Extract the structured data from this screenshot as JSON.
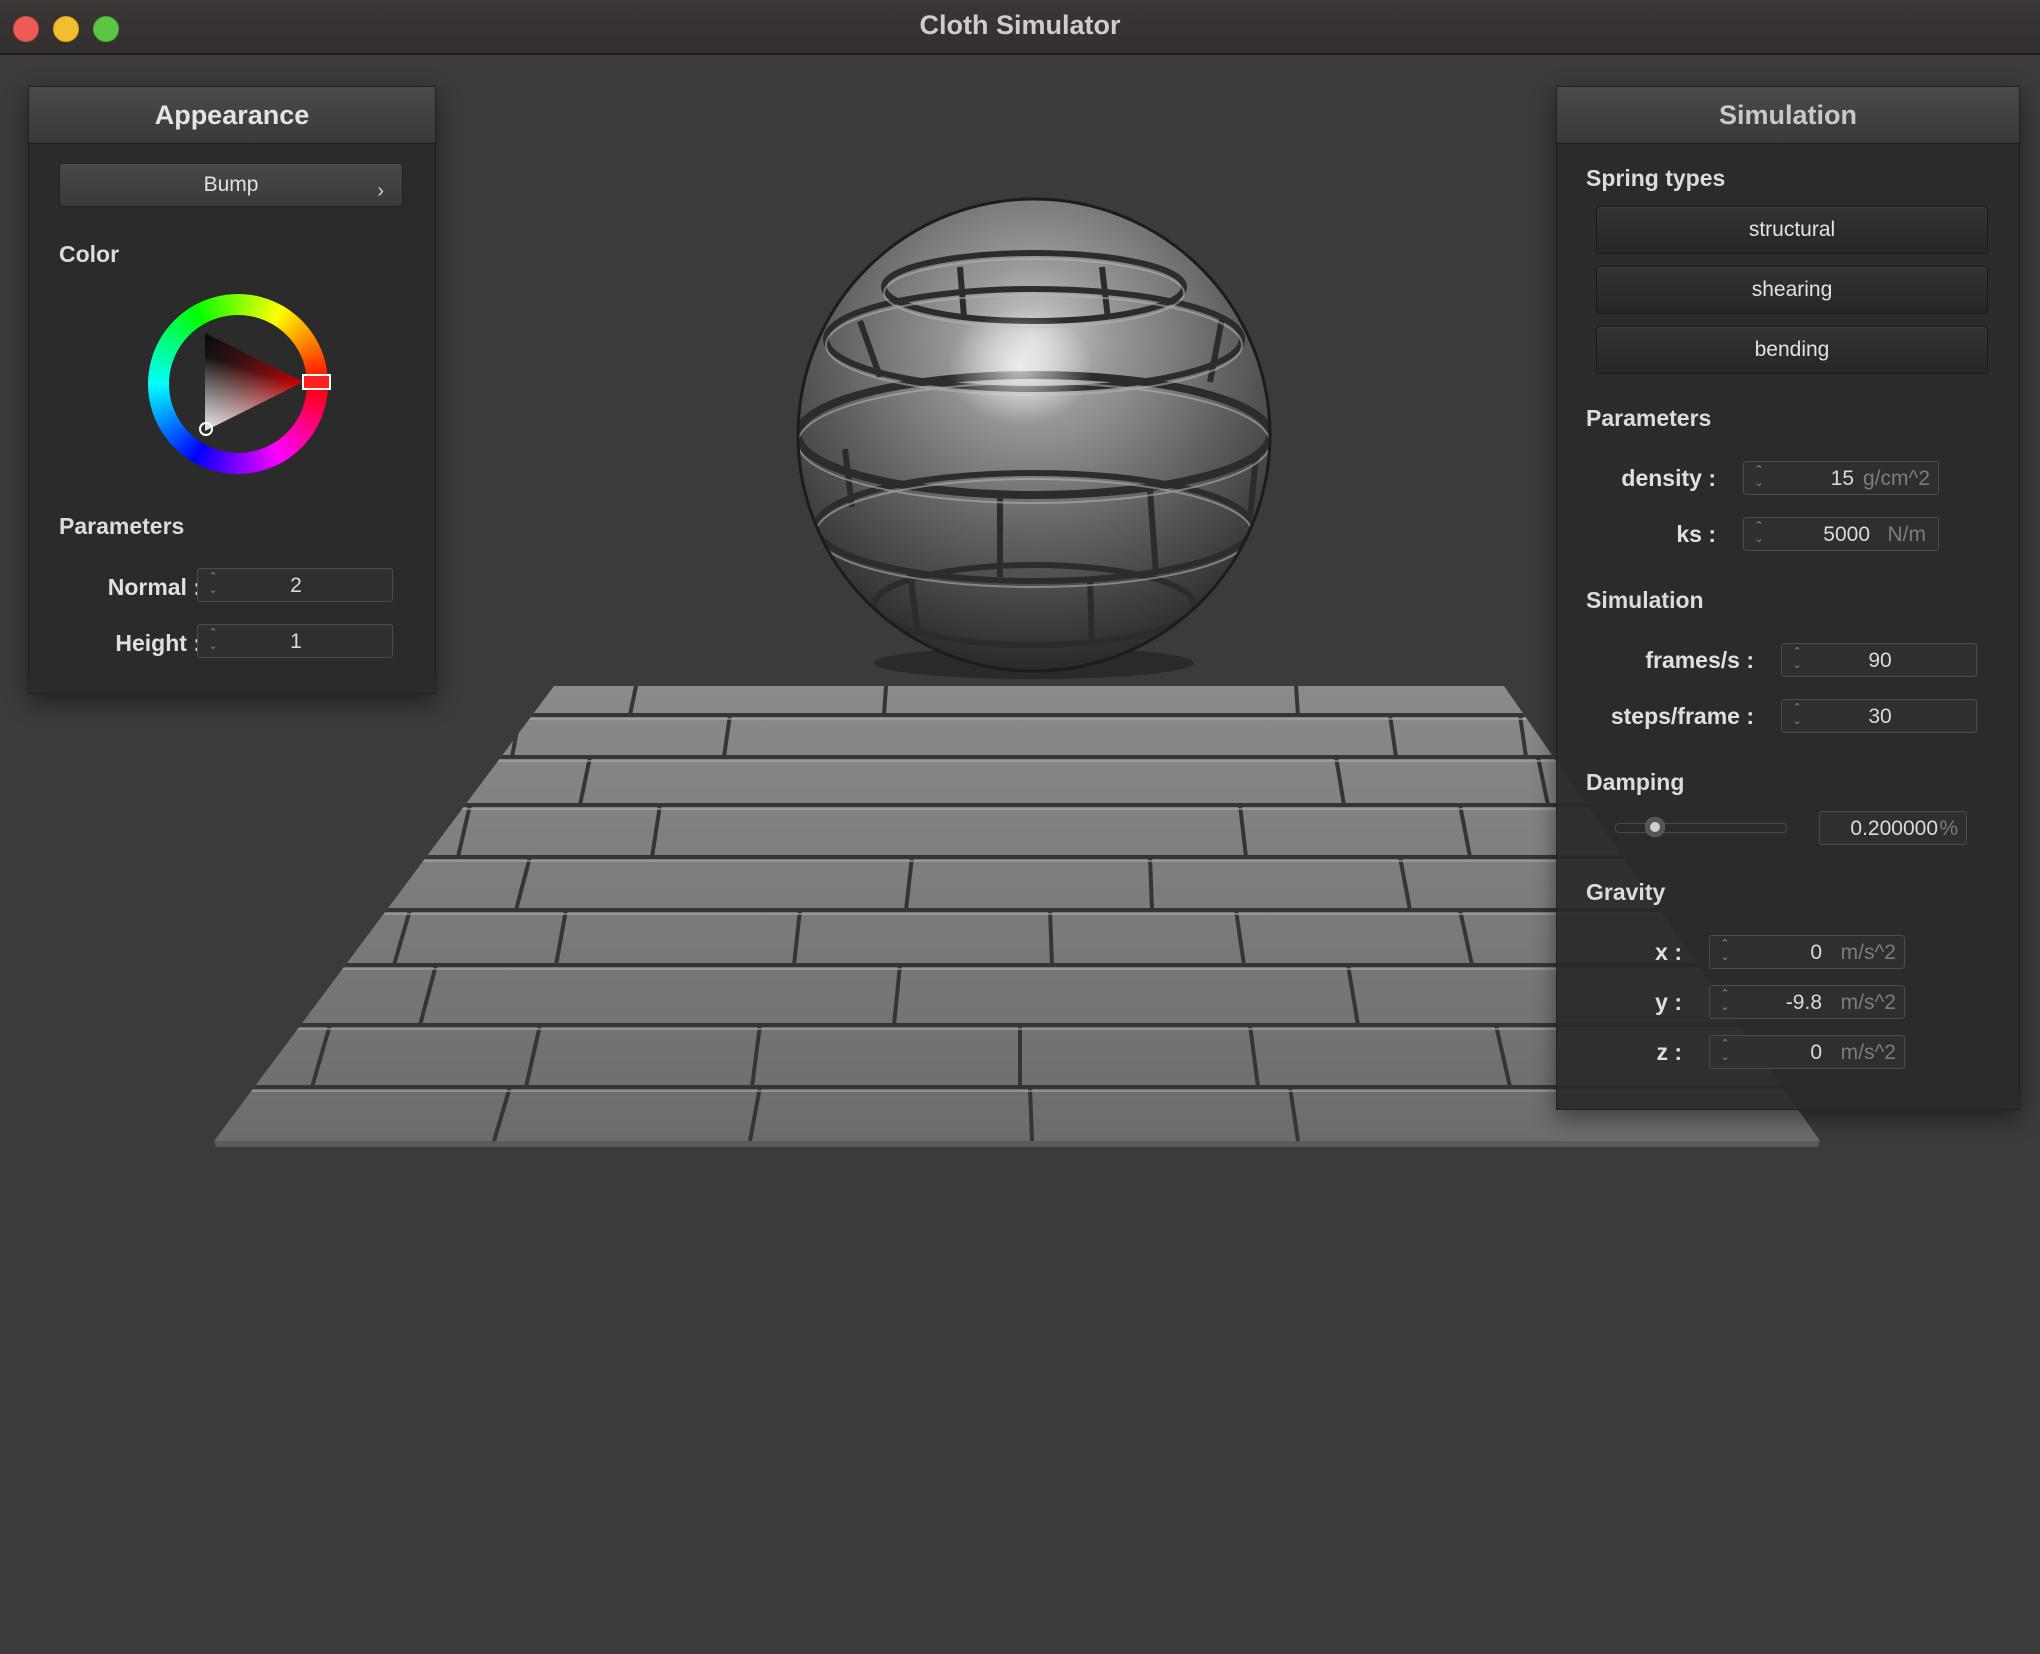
{
  "window": {
    "title": "Cloth Simulator"
  },
  "appearance": {
    "header": "Appearance",
    "shader_selected": "Bump",
    "color_label": "Color",
    "selected_color": "#ff0000",
    "parameters_label": "Parameters",
    "normal": {
      "label": "Normal :",
      "value": "2"
    },
    "height": {
      "label": "Height :",
      "value": "1"
    }
  },
  "simulation": {
    "header": "Simulation",
    "spring_types_label": "Spring types",
    "springs": [
      "structural",
      "shearing",
      "bending"
    ],
    "parameters_label": "Parameters",
    "density": {
      "label": "density :",
      "value": "15",
      "unit": "g/cm^2"
    },
    "ks": {
      "label": "ks :",
      "value": "5000",
      "unit": "N/m"
    },
    "simulation_label": "Simulation",
    "fps": {
      "label": "frames/s :",
      "value": "90"
    },
    "steps": {
      "label": "steps/frame :",
      "value": "30"
    },
    "damping_label": "Damping",
    "damping": {
      "value": "0.200000",
      "unit": "%",
      "slider_fraction": 0.2
    },
    "gravity_label": "Gravity",
    "gravity": [
      {
        "label": "x :",
        "value": "0",
        "unit": "m/s^2"
      },
      {
        "label": "y :",
        "value": "-9.8",
        "unit": "m/s^2"
      },
      {
        "label": "z :",
        "value": "0",
        "unit": "m/s^2"
      }
    ]
  }
}
